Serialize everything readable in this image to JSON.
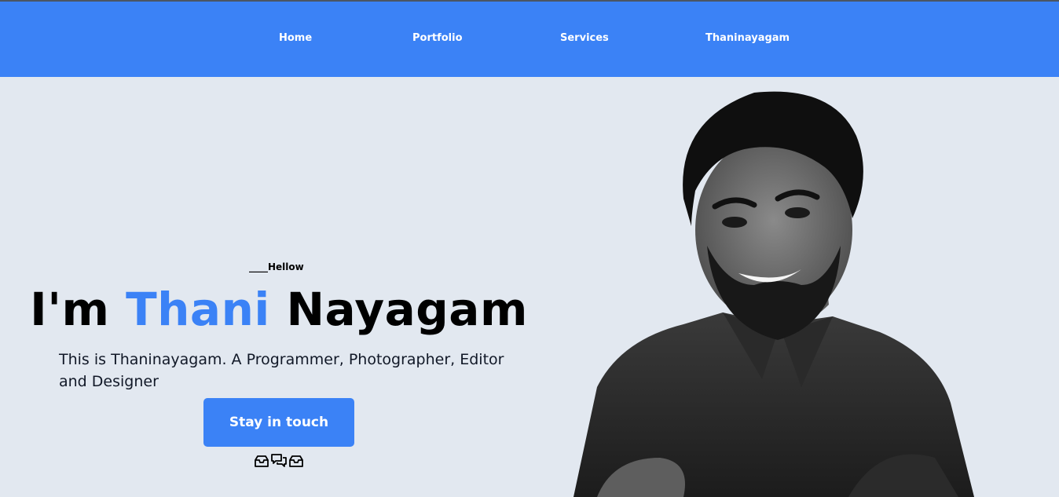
{
  "nav": {
    "items": [
      {
        "label": "Home"
      },
      {
        "label": "Portfolio"
      },
      {
        "label": "Services"
      },
      {
        "label": "Thaninayagam"
      }
    ]
  },
  "hero": {
    "greeting": "____Hellow",
    "headline_prefix": "I'm ",
    "headline_accent": "Thani",
    "headline_suffix": " Nayagam",
    "description": "This is Thaninayagam. A Programmer, Photographer, Editor and Designer",
    "cta_label": "Stay in touch",
    "social_icons": [
      "inbox-icon",
      "chat-icon",
      "inbox-icon"
    ]
  },
  "colors": {
    "accent": "#3b82f6",
    "background": "#e2e8f0",
    "text": "#000000"
  },
  "portrait": {
    "subject": "grayscale portrait photo of smiling man with arms crossed"
  }
}
